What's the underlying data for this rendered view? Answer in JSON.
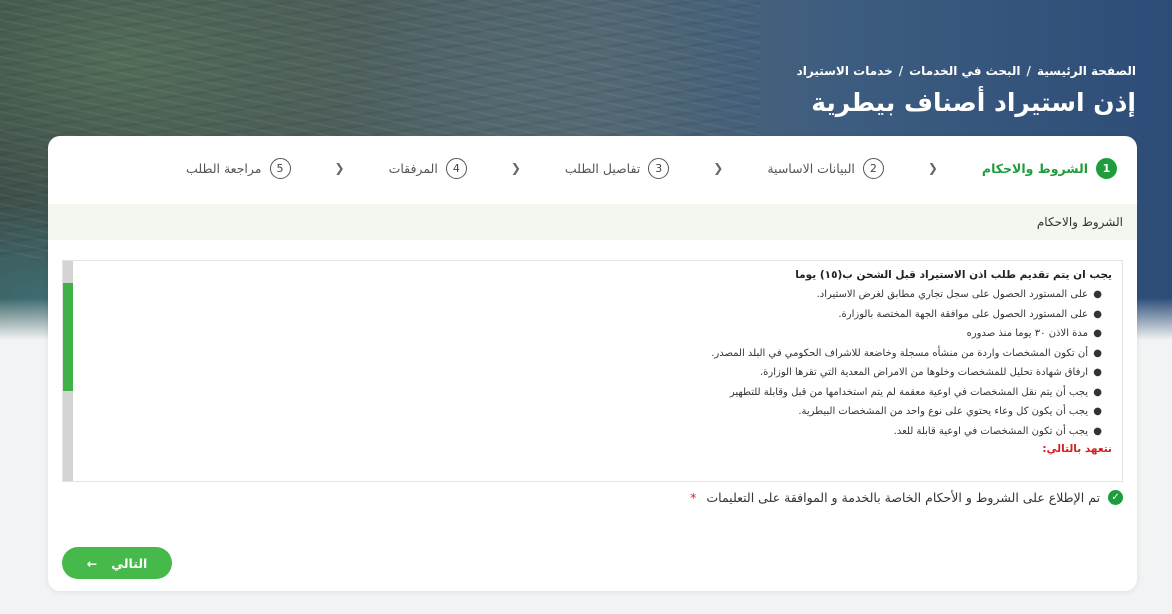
{
  "breadcrumb": {
    "home": "الصفحة الرئيسية",
    "search": "البحث في الخدمات",
    "current": "خدمات الاستيراد",
    "separator": "/"
  },
  "page_title": "إذن استيراد أصناف بيطرية",
  "steps": [
    {
      "num": "1",
      "label": "الشروط والاحكام",
      "active": true
    },
    {
      "num": "2",
      "label": "البيانات الاساسية"
    },
    {
      "num": "3",
      "label": "تفاصيل الطلب"
    },
    {
      "num": "4",
      "label": "المرفقات"
    },
    {
      "num": "5",
      "label": "مراجعة الطلب"
    }
  ],
  "section_title": "الشروط والاحكام",
  "terms": {
    "heading": "يجب ان يتم تقديم طلب اذن الاستيراد قبل الشحن ب(١٥) يوما",
    "items": [
      "على المستورد الحصول على سجل تجاري مطابق لغرض الاستيراد.",
      "على المستورد الحصول على موافقة الجهة المختصة بالوزارة.",
      "مدة الاذن ٣٠ يوما منذ صدوره",
      "أن تكون المشخصات واردة من منشأه مسجلة وخاضعة للاشراف الحكومي في البلد المصدر.",
      "ارفاق شهادة تحليل  للمشخصات وخلوها من الامراض المعدية التي تقرها الوزارة.",
      "يجب أن يتم نقل المشخصات في اوعية معقمة لم يتم استخدامها من قبل وقابلة للتطهير",
      "يجب أن يكون كل وعاء يحتوي على نوع واحد من المشخصات البيطرية.",
      "يجب أن تكون المشخصات في اوعية قابلة للعد."
    ],
    "pledge": "نتعهد بالتالي:"
  },
  "agreement": {
    "label": "تم الإطلاع على الشروط و الأحكام الخاصة بالخدمة و الموافقة على التعليمات",
    "required_mark": "*",
    "checked": true
  },
  "next_button": {
    "label": "التالي",
    "arrow": "←"
  },
  "colors": {
    "accent": "#1f9d3d",
    "button": "#45b94a",
    "required": "#d41f1f"
  }
}
